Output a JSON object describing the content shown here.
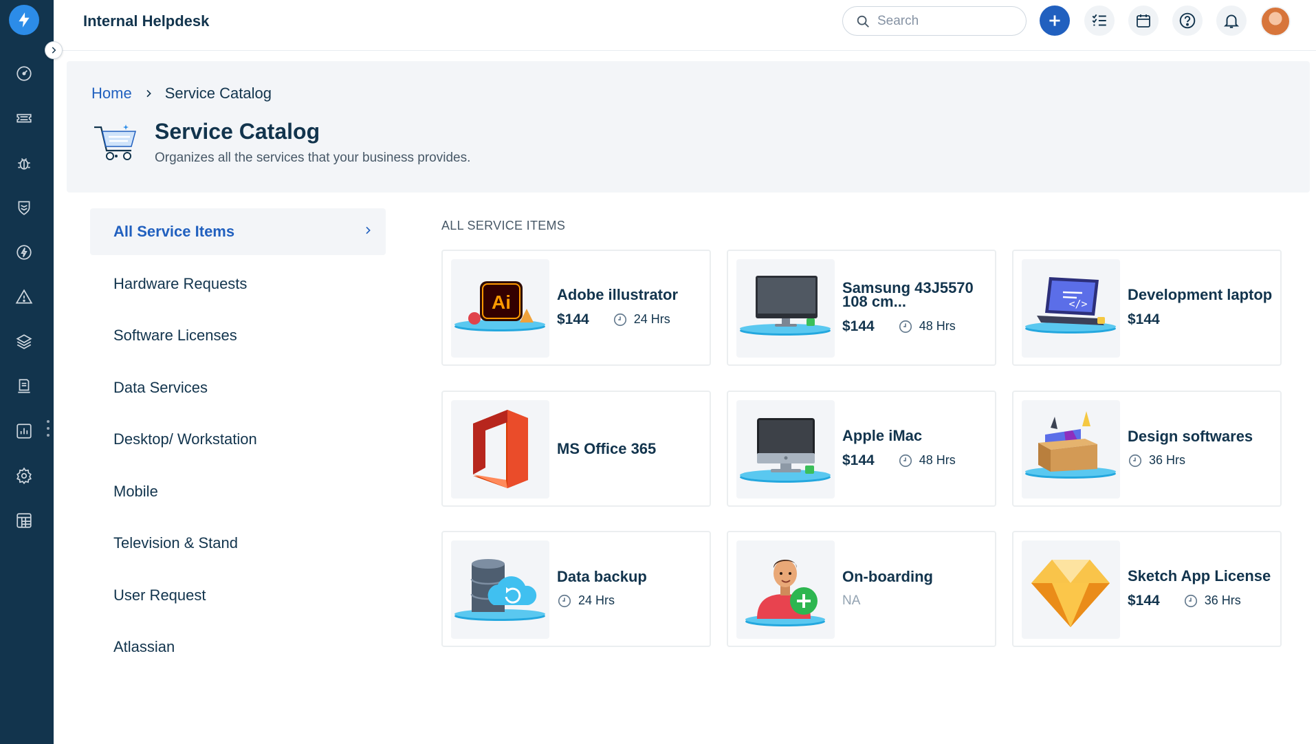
{
  "app": {
    "title": "Internal Helpdesk"
  },
  "header": {
    "search_placeholder": "Search",
    "actions": [
      "new-item",
      "todo",
      "calendar",
      "help",
      "notifications",
      "profile"
    ]
  },
  "nav": {
    "items": [
      "dashboard",
      "tickets",
      "problems",
      "changes",
      "releases",
      "alerts",
      "assets",
      "solutions",
      "reports",
      "admin",
      "apps"
    ]
  },
  "breadcrumb": {
    "home": "Home",
    "current": "Service Catalog"
  },
  "page": {
    "title": "Service Catalog",
    "subtitle": "Organizes all the services that your business provides."
  },
  "categories": [
    {
      "label": "All Service Items",
      "active": true
    },
    {
      "label": "Hardware Requests"
    },
    {
      "label": "Software Licenses"
    },
    {
      "label": "Data Services"
    },
    {
      "label": "Desktop/ Workstation"
    },
    {
      "label": "Mobile"
    },
    {
      "label": "Television & Stand"
    },
    {
      "label": "User Request"
    },
    {
      "label": "Atlassian"
    }
  ],
  "catalog": {
    "section_label": "ALL SERVICE ITEMS",
    "items": [
      {
        "name": "Adobe illustrator",
        "price": "$144",
        "sla": "24 Hrs",
        "icon": "adobe-illustrator-icon"
      },
      {
        "name": "Samsung 43J5570 108 cm...",
        "price": "$144",
        "sla": "48 Hrs",
        "icon": "monitor-icon"
      },
      {
        "name": "Development laptop",
        "price": "$144",
        "sla": "",
        "icon": "laptop-icon"
      },
      {
        "name": "MS Office 365",
        "price": "",
        "sla": "",
        "icon": "ms-office-icon"
      },
      {
        "name": "Apple iMac",
        "price": "$144",
        "sla": "48 Hrs",
        "icon": "imac-icon"
      },
      {
        "name": "Design softwares",
        "price": "",
        "sla": "36 Hrs",
        "icon": "design-box-icon"
      },
      {
        "name": "Data backup",
        "price": "",
        "sla": "24 Hrs",
        "icon": "data-backup-icon"
      },
      {
        "name": "On-boarding",
        "price": "",
        "sla": "",
        "na": "NA",
        "icon": "onboarding-person-icon"
      },
      {
        "name": "Sketch App License",
        "price": "$144",
        "sla": "36 Hrs",
        "icon": "sketch-diamond-icon"
      }
    ]
  },
  "colors": {
    "rail": "#12344d",
    "accent": "#2160bf",
    "logo": "#2c8ce8",
    "band": "#f3f5f8"
  }
}
